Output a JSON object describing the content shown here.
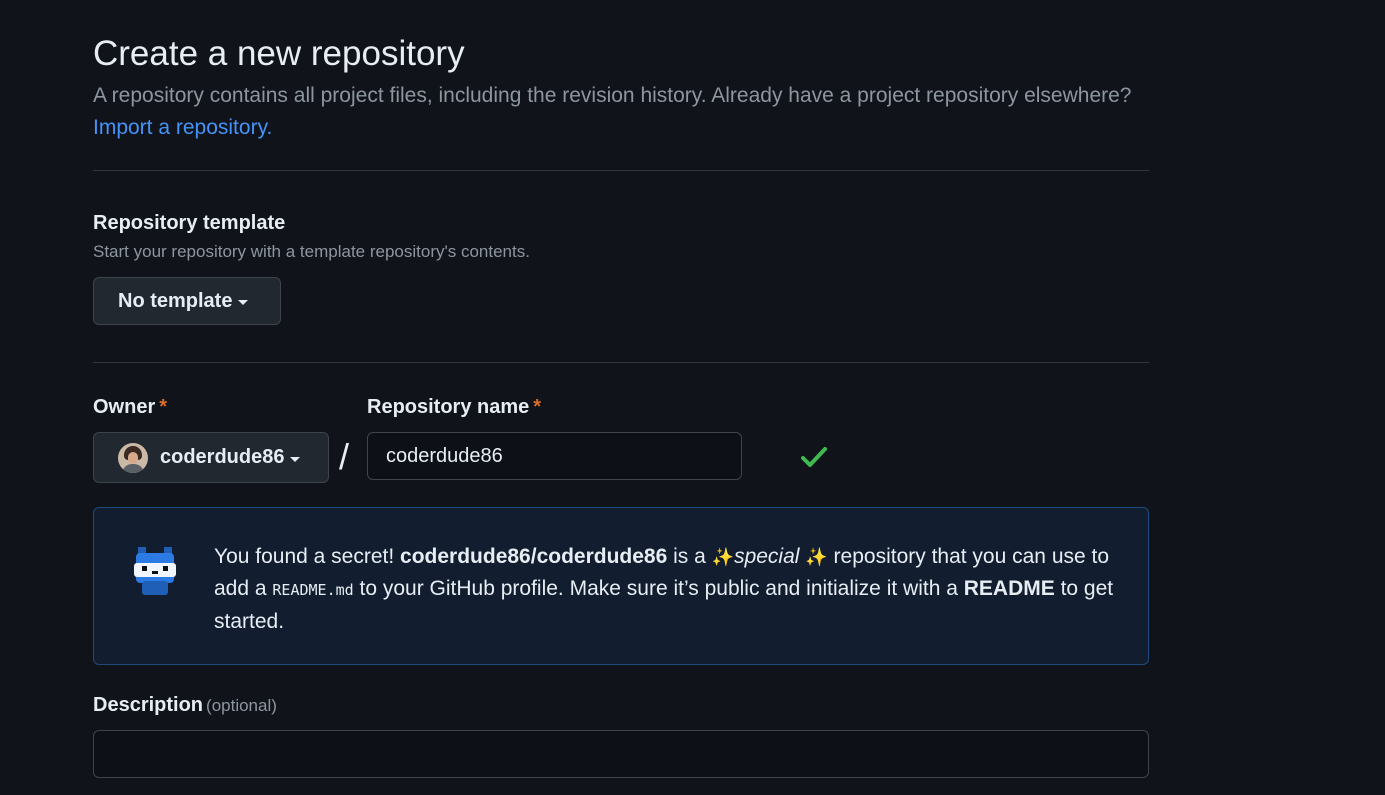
{
  "header": {
    "title": "Create a new repository",
    "subtitle": "A repository contains all project files, including the revision history. Already have a project repository elsewhere?",
    "import_link": "Import a repository."
  },
  "template": {
    "label": "Repository template",
    "note": "Start your repository with a template repository's contents.",
    "button_label": "No template"
  },
  "owner": {
    "label": "Owner",
    "required_mark": "*",
    "value": "coderdude86"
  },
  "repo_name": {
    "label": "Repository name",
    "required_mark": "*",
    "value": "coderdude86",
    "valid": true
  },
  "secret_notice": {
    "intro": "You found a secret! ",
    "repo_path": "coderdude86/coderdude86",
    "is_a": " is a ",
    "sparkle": "✨",
    "special": "special",
    "after_special": " repository that you can use to add a ",
    "readme_file": "README.md",
    "middle": " to your GitHub profile. Make sure it’s public and initialize it with a ",
    "readme_bold": "README",
    "ending": " to get started."
  },
  "description": {
    "label": "Description",
    "optional": "(optional)",
    "value": ""
  },
  "colors": {
    "background": "#10131a",
    "link": "#4493f8",
    "required": "#db6d28",
    "success": "#3fb950",
    "notice_bg": "#121d2f",
    "notice_border": "#1f4a7d"
  },
  "icons": [
    "caret-down-icon",
    "check-icon",
    "mona-mascot-icon",
    "sparkles-icon"
  ]
}
